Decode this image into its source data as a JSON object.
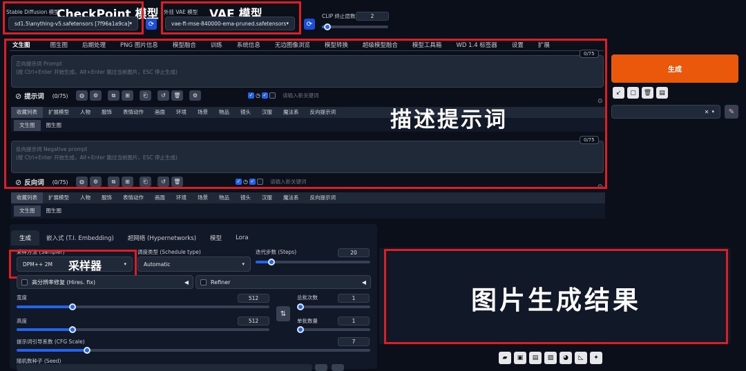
{
  "top": {
    "sd_model_label": "Stable Diffusion 模型",
    "sd_model_annot": "CheckPoint 模型",
    "sd_model_value": "sd1.5\\anything-v5.safetensors [7f96a1a9ca]",
    "vae_label": "外挂 VAE 模型",
    "vae_annot": "VAE 模型",
    "vae_value": "vae-ft-mse-840000-ema-pruned.safetensors",
    "clip_label": "CLIP 终止层数",
    "clip_value": "2",
    "clip_level": 0.08
  },
  "tabs": [
    "文生图",
    "图生图",
    "后期处理",
    "PNG 图片信息",
    "模型融合",
    "训练",
    "系统信息",
    "无边图像浏览",
    "模型转换",
    "超级模型融合",
    "模型工具箱",
    "WD 1.4 标签器",
    "设置",
    "扩展"
  ],
  "prompt": {
    "placeholder_line1": "正向提示词 Prompt",
    "placeholder_line2": "(按 Ctrl+Enter 开始生成，Alt+Enter 跳过当前图片，ESC 停止生成)",
    "counter": "0/75",
    "label": "提示词",
    "count": "(0/75)",
    "keyword_placeholder": "请输入新关键词"
  },
  "prompt_annot": "描述提示词",
  "negative": {
    "placeholder_line1": "反向提示词 Negative prompt",
    "placeholder_line2": "(按 Ctrl+Enter 开始生成，Alt+Enter 跳过当前图片，ESC 停止生成)",
    "counter": "0/75",
    "label": "反向词",
    "count": "(0/75)",
    "keyword_placeholder": "请输入新关键词"
  },
  "category_tabs": [
    "收藏列表",
    "扩展模型",
    "人物",
    "服饰",
    "表情动作",
    "画面",
    "环境",
    "场景",
    "物品",
    "镜头",
    "汉服",
    "魔法系",
    "反向提示词"
  ],
  "category_subtabs": [
    "文生图",
    "图生图"
  ],
  "generate_label": "生成",
  "bottom_tabs": [
    "生成",
    "嵌入式 (T.I. Embedding)",
    "超网络 (Hypernetworks)",
    "模型",
    "Lora"
  ],
  "sampler": {
    "label": "采样方法 (Sampler)",
    "value": "DPM++ 2M",
    "annot": "采样器"
  },
  "schedule": {
    "label": "调度类型 (Schedule type)",
    "value": "Automatic"
  },
  "steps": {
    "label": "迭代步数 (Steps)",
    "value": "20",
    "level": 0.14
  },
  "hires": {
    "label": "高分辨率修复 (Hires. fix)"
  },
  "refiner": {
    "label": "Refiner"
  },
  "width": {
    "label": "宽度",
    "value": "512",
    "level": 0.22
  },
  "height": {
    "label": "高度",
    "value": "512",
    "level": 0.22
  },
  "batch_count": {
    "label": "总批次数",
    "value": "1",
    "level": 0.0
  },
  "batch_size": {
    "label": "单批数量",
    "value": "1",
    "level": 0.0
  },
  "cfg": {
    "label": "提示词引导系数 (CFG Scale)",
    "value": "7",
    "level": 0.2
  },
  "seed": {
    "label": "随机数种子 (Seed)"
  },
  "result_annot": "图片生成结果",
  "colors": {
    "accent": "#2563eb",
    "generate": "#ea580c",
    "annotation": "#e11d24"
  }
}
